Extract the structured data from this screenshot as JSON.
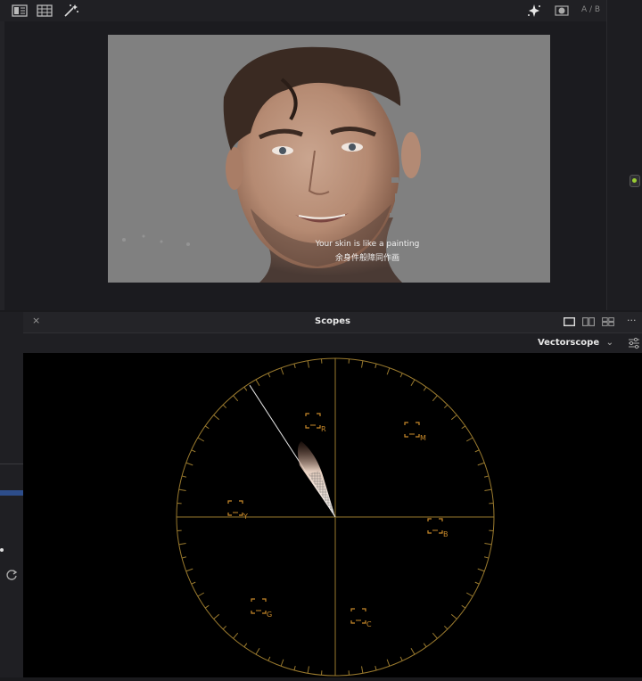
{
  "viewer": {
    "ab_label": "A / B",
    "subtitle_line1": "Your skin is like a painting",
    "subtitle_line2": "余身件般障同作画"
  },
  "scopes": {
    "title": "Scopes",
    "close_glyph": "×",
    "mode": "Vectorscope",
    "mode_chevron": "⌄",
    "more_glyph": "···",
    "targets": [
      {
        "label": "R"
      },
      {
        "label": "M"
      },
      {
        "label": "B"
      },
      {
        "label": "C"
      },
      {
        "label": "G"
      },
      {
        "label": "Y"
      }
    ]
  },
  "icons": [
    "viewer-layout-icon",
    "filmstrip-icon",
    "magic-wand-icon",
    "sparkle-icon",
    "mask-icon",
    "refresh-icon",
    "scope-settings-icon"
  ],
  "colors": {
    "graticule": "#9a7a2e",
    "target": "#c98a2a",
    "background": "#000000",
    "panel": "#242428"
  }
}
